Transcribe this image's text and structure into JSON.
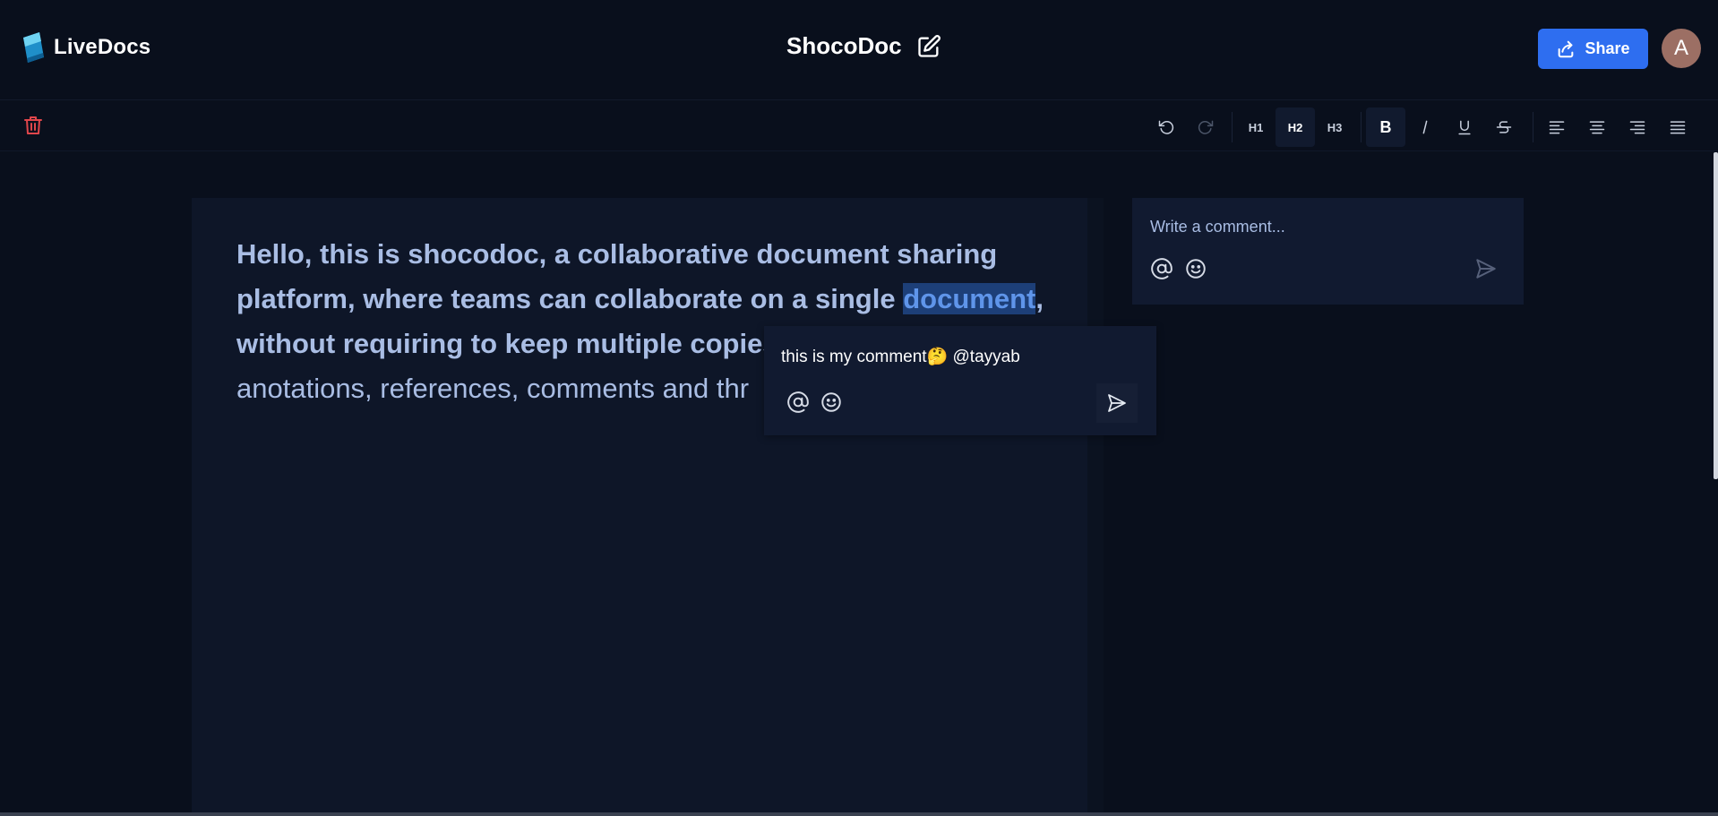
{
  "app": {
    "name": "LiveDocs"
  },
  "document": {
    "title": "ShocoDoc"
  },
  "header": {
    "share_label": "Share",
    "avatar_initial": "A"
  },
  "toolbar": {
    "headings": [
      "H1",
      "H2",
      "H3"
    ],
    "active_heading": "H2",
    "bold_label": "B"
  },
  "content": {
    "bold_part_1": "Hello, this is shocodoc, a collaborative document sharing platform, where teams can collaborate on a single ",
    "highlighted_word": "document",
    "bold_part_2": ", without requiring to keep multiple copies",
    "plain_part": "anotations, references, comments and thr"
  },
  "comments": {
    "composer_placeholder": "Write a comment...",
    "floating_draft": "this is my comment🤔 @tayyab"
  },
  "colors": {
    "accent": "#2e6ef0",
    "highlight_bg": "#1d3f78",
    "delete": "#e0464b"
  }
}
